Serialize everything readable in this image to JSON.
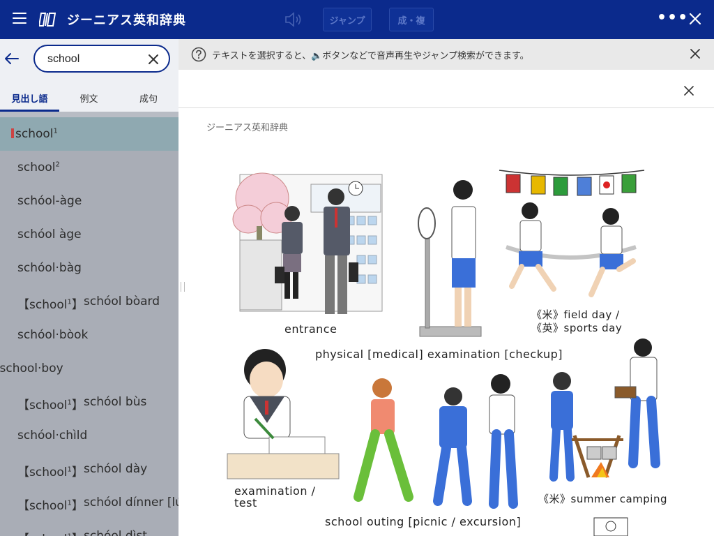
{
  "header": {
    "title": "ジーニアス英和辞典",
    "jump_label": "ジャンプ",
    "seifuku_label": "成・複",
    "more_label": "•••"
  },
  "search": {
    "value": "school"
  },
  "tabs": [
    {
      "label": "見出し語",
      "active": true
    },
    {
      "label": "例文",
      "active": false
    },
    {
      "label": "成句",
      "active": false
    }
  ],
  "entries": [
    {
      "mark": "",
      "ref": "",
      "text": "school",
      "sup": "1",
      "selected": true
    },
    {
      "mark": "",
      "ref": "",
      "text": "school",
      "sup": "2",
      "selected": false
    },
    {
      "mark": "",
      "ref": "",
      "text": "schóol-àge",
      "sup": "",
      "selected": false
    },
    {
      "mark": "",
      "ref": "",
      "text": "schóol àge",
      "sup": "",
      "selected": false
    },
    {
      "mark": "",
      "ref": "",
      "text": "schóol·bàg",
      "sup": "",
      "selected": false
    },
    {
      "mark": "",
      "ref": "【school",
      "ref_sup": "1",
      "ref_end": "】",
      "text": "schóol bòard",
      "sup": "",
      "selected": false
    },
    {
      "mark": "",
      "ref": "",
      "text": "schóol·bòok",
      "sup": "",
      "selected": false
    },
    {
      "mark": "*",
      "ref": "",
      "text": "school·boy",
      "sup": "",
      "selected": false
    },
    {
      "mark": "",
      "ref": "【school",
      "ref_sup": "1",
      "ref_end": "】",
      "text": "schóol bùs",
      "sup": "",
      "selected": false
    },
    {
      "mark": "",
      "ref": "",
      "text": "schóol·chìld",
      "sup": "",
      "selected": false
    },
    {
      "mark": "",
      "ref": "【school",
      "ref_sup": "1",
      "ref_end": "】",
      "text": "schóol dày",
      "sup": "",
      "selected": false
    },
    {
      "mark": "",
      "ref": "【school",
      "ref_sup": "1",
      "ref_end": "】",
      "text": "schóol dínner [lú",
      "sup": "",
      "selected": false
    },
    {
      "mark": "",
      "ref": "【school",
      "ref_sup": "1",
      "ref_end": "】",
      "text": "schóol dìst",
      "sup": "",
      "selected": false
    }
  ],
  "notice": {
    "text": "テキストを選択すると、🔈ボタンなどで音声再生やジャンプ検索ができます。"
  },
  "dictionary_name": "ジーニアス英和辞典",
  "illustration": {
    "captions": {
      "entrance": "entrance",
      "field_day_1": "《米》field day /",
      "field_day_2": "《英》sports day",
      "physical": "physical [medical] examination [checkup]",
      "exam_1": "examination /",
      "exam_2": "test",
      "outing": "school outing [picnic / excursion]",
      "camping": "《米》summer camping"
    }
  },
  "colors": {
    "header": "#0b2a8c",
    "selected_row": "#8fa9b1",
    "list_bg": "#a9adb6"
  }
}
